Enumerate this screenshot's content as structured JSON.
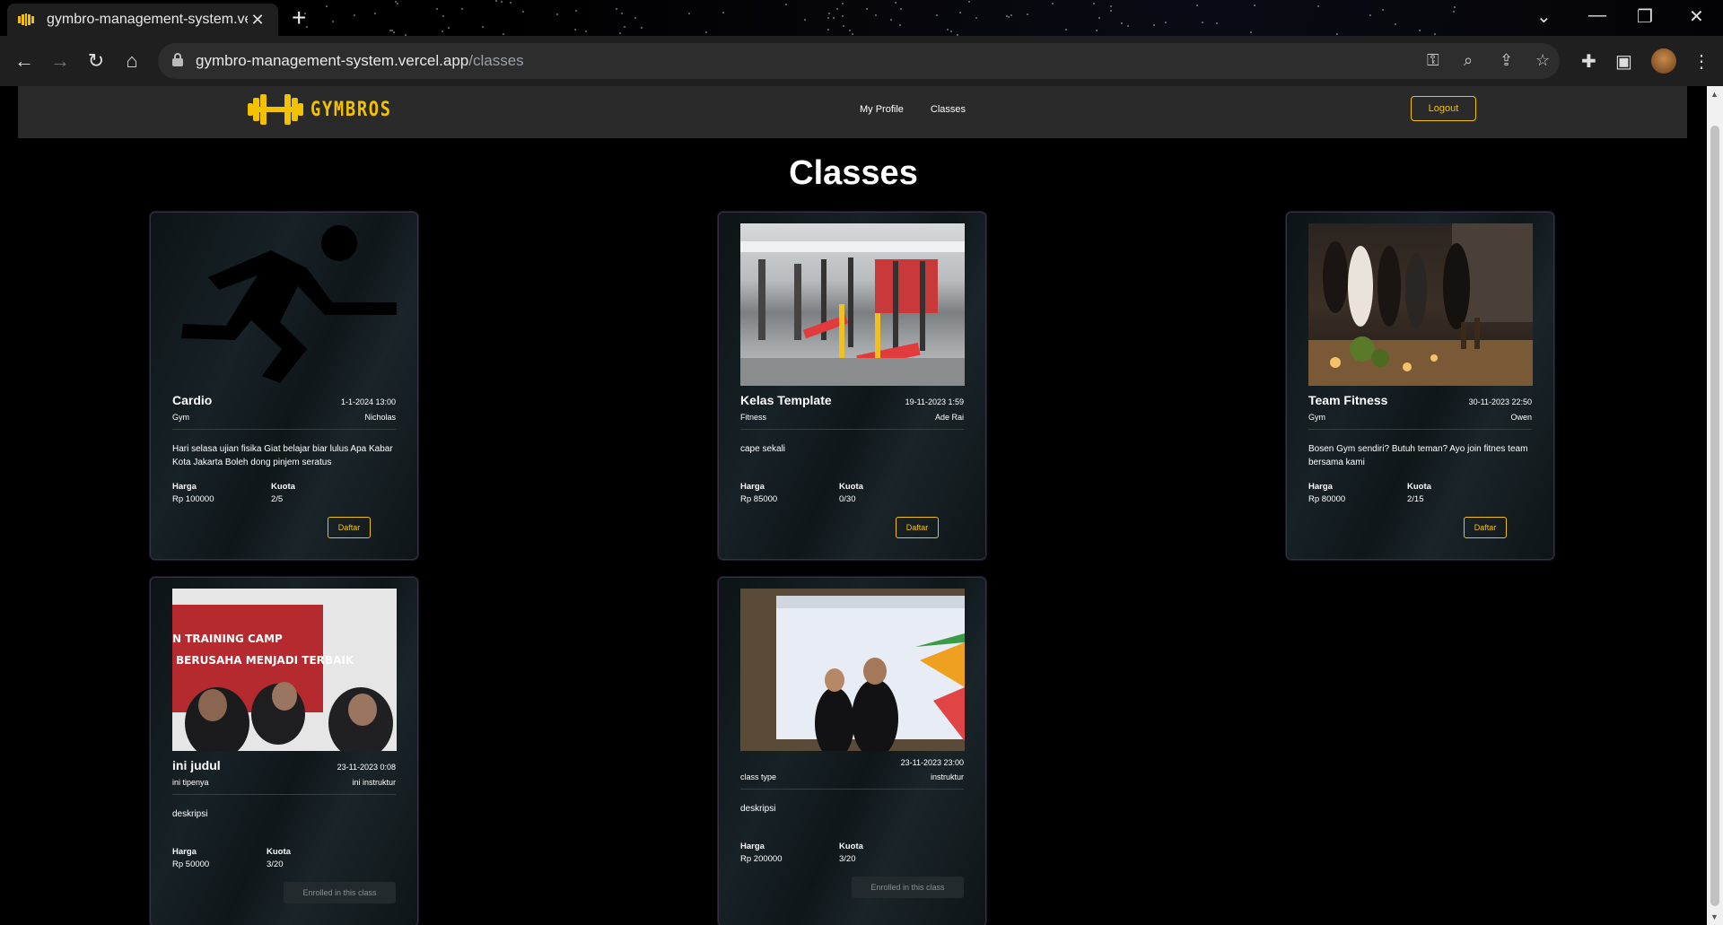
{
  "browser": {
    "tab_title": "gymbro-management-system.ve",
    "url_host": "gymbro-management-system.vercel.app",
    "url_path": "/classes",
    "icons": [
      "back-icon",
      "forward-icon",
      "reload-icon",
      "home-icon",
      "lock-icon",
      "key-icon",
      "zoom-icon",
      "share-icon",
      "star-icon",
      "extensions-icon",
      "sidebar-icon",
      "menu-icon"
    ]
  },
  "header": {
    "logo_text": "GYMBROS",
    "nav": [
      "My Profile",
      "Classes"
    ],
    "logout_label": "Logout",
    "accent_color": "#f2c200"
  },
  "page": {
    "title": "Classes"
  },
  "labels": {
    "harga": "Harga",
    "kuota": "Kuota",
    "daftar": "Daftar",
    "enrolled": "Enrolled in this class"
  },
  "classes": [
    {
      "title": "Cardio",
      "date": "1-1-2024 13:00",
      "type": "Gym",
      "instructor": "Nicholas",
      "description": "Hari selasa ujian fisika Giat belajar biar lulus Apa Kabar Kota Jakarta Boleh dong pinjem seratus",
      "price": "Rp 100000",
      "quota": "2/5",
      "action": "Daftar",
      "image": "running-person-icon"
    },
    {
      "title": "Kelas Template",
      "date": "19-11-2023 1:59",
      "type": "Fitness",
      "instructor": "Ade Rai",
      "description": "cape sekali",
      "price": "Rp 85000",
      "quota": "0/30",
      "action": "Daftar",
      "image": "gym-photo"
    },
    {
      "title": "Team Fitness",
      "date": "30-11-2023 22:50",
      "type": "Gym",
      "instructor": "Owen",
      "description": "Bosen Gym sendiri? Butuh teman? Ayo join fitnes team bersama kami",
      "price": "Rp 80000",
      "quota": "2/15",
      "action": "Daftar",
      "image": "party-photo"
    },
    {
      "title": "ini judul",
      "date": "23-11-2023 0:08",
      "type": "ini tipenya",
      "instructor": "ini instruktur",
      "description": "deskripsi",
      "price": "Rp 50000",
      "quota": "3/20",
      "action": "Enrolled in this class",
      "image": "training-camp-photo",
      "banner_line1": "N TRAINING CAMP",
      "banner_line2": "BERUSAHA MENJADI TERBAIK"
    },
    {
      "title": "",
      "date": "23-11-2023 23:00",
      "type": "class type",
      "instructor": "instruktur",
      "description": "deskripsi",
      "price": "Rp 200000",
      "quota": "3/20",
      "action": "Enrolled in this class",
      "image": "presentation-photo"
    }
  ]
}
